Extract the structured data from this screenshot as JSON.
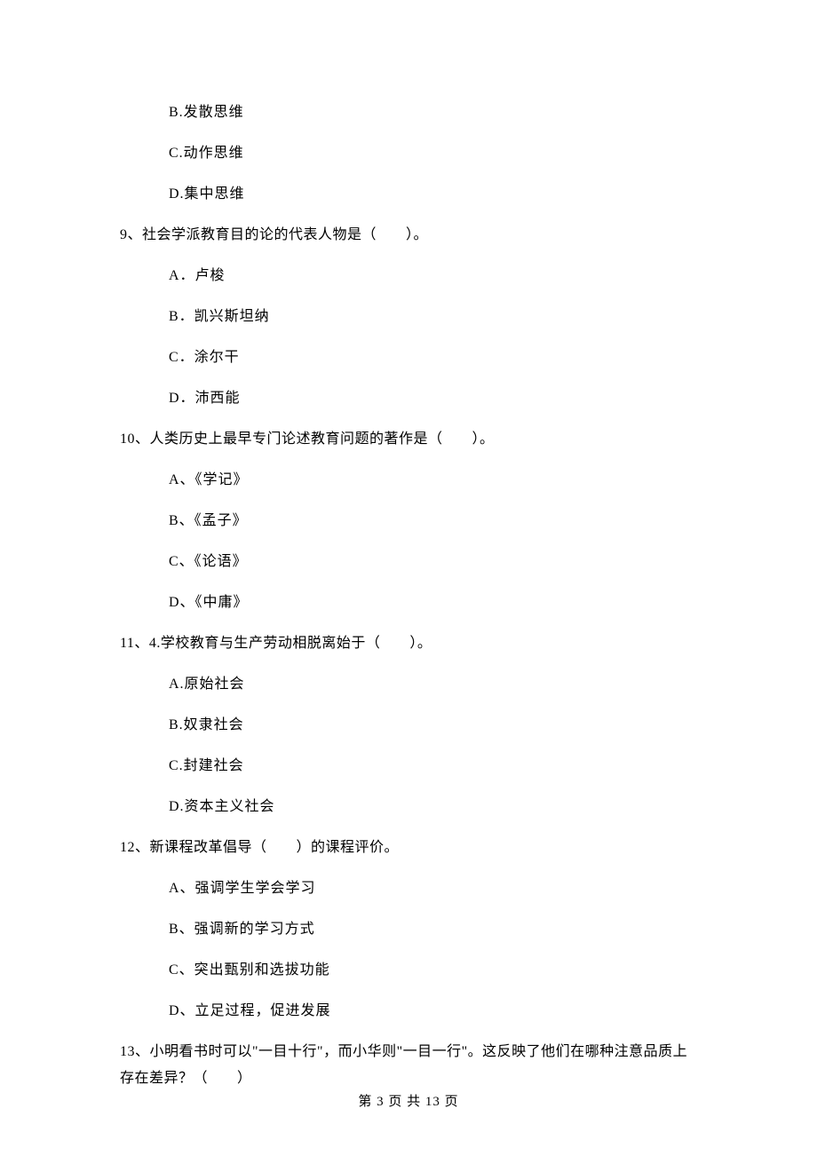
{
  "q8_continuation": {
    "options": [
      "B.发散思维",
      "C.动作思维",
      "D.集中思维"
    ]
  },
  "q9": {
    "text": "9、社会学派教育目的论的代表人物是（　　）。",
    "options": [
      "A．卢梭",
      "B．凯兴斯坦纳",
      "C．涂尔干",
      "D．沛西能"
    ]
  },
  "q10": {
    "text": "10、人类历史上最早专门论述教育问题的著作是（　　）。",
    "options": [
      "A、《学记》",
      "B、《孟子》",
      "C、《论语》",
      "D、《中庸》"
    ]
  },
  "q11": {
    "text": "11、4.学校教育与生产劳动相脱离始于（　　）。",
    "options": [
      "A.原始社会",
      "B.奴隶社会",
      "C.封建社会",
      "D.资本主义社会"
    ]
  },
  "q12": {
    "text": "12、新课程改革倡导（　　）的课程评价。",
    "options": [
      "A、强调学生学会学习",
      "B、强调新的学习方式",
      "C、突出甄别和选拔功能",
      "D、立足过程，促进发展"
    ]
  },
  "q13": {
    "text_line1": "13、小明看书时可以\"一目十行\"，而小华则\"一目一行\"。这反映了他们在哪种注意品质上",
    "text_line2": "存在差异？（　　）"
  },
  "footer": "第 3 页 共 13 页"
}
